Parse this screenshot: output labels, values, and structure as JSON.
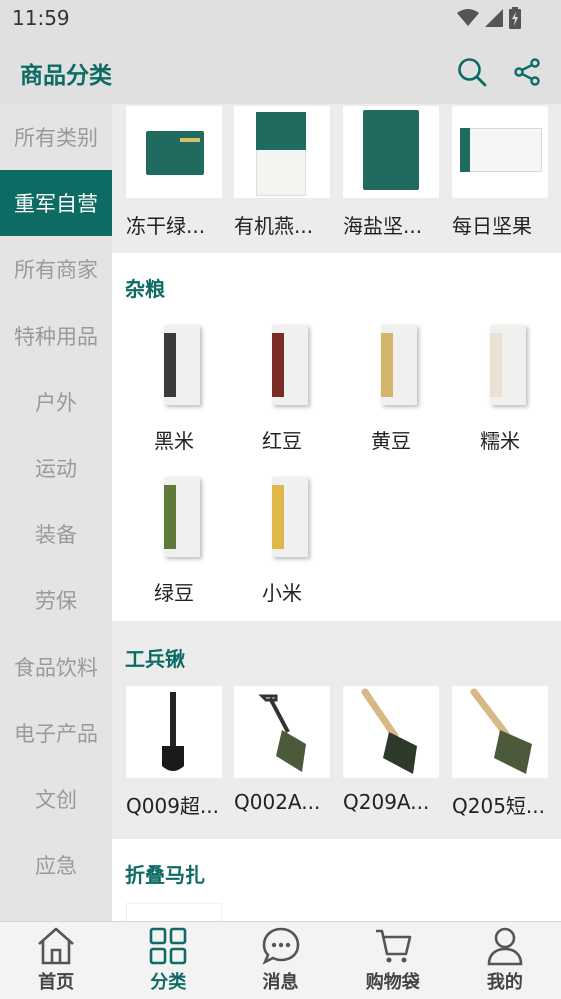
{
  "status_bar": {
    "time": "11:59"
  },
  "header": {
    "title": "商品分类"
  },
  "sidebar": {
    "items": [
      {
        "label": "所有类别"
      },
      {
        "label": "重军自营"
      },
      {
        "label": "所有商家"
      },
      {
        "label": "特种用品"
      },
      {
        "label": "户外"
      },
      {
        "label": "运动"
      },
      {
        "label": "装备"
      },
      {
        "label": "劳保"
      },
      {
        "label": "食品饮料"
      },
      {
        "label": "电子产品"
      },
      {
        "label": "文创"
      },
      {
        "label": "应急"
      }
    ],
    "active_index": 1
  },
  "sections": {
    "top_products": [
      {
        "label": "冻干绿..."
      },
      {
        "label": "有机燕..."
      },
      {
        "label": "海盐坚..."
      },
      {
        "label": "每日坚果"
      }
    ],
    "grains": {
      "title": "杂粮",
      "items": [
        {
          "label": "黑米",
          "color": "#3a3a3a"
        },
        {
          "label": "红豆",
          "color": "#7a2b22"
        },
        {
          "label": "黄豆",
          "color": "#d4b36a"
        },
        {
          "label": "糯米",
          "color": "#e8e2d2"
        },
        {
          "label": "绿豆",
          "color": "#5f7a3a"
        },
        {
          "label": "小米",
          "color": "#e0b84a"
        }
      ]
    },
    "shovels": {
      "title": "工兵锹",
      "items": [
        {
          "label": "Q009超..."
        },
        {
          "label": "Q002A..."
        },
        {
          "label": "Q209A..."
        },
        {
          "label": "Q205短..."
        }
      ]
    },
    "folding_stool": {
      "title": "折叠马扎"
    }
  },
  "bottom_nav": {
    "items": [
      {
        "label": "首页",
        "icon": "home-icon"
      },
      {
        "label": "分类",
        "icon": "grid-icon"
      },
      {
        "label": "消息",
        "icon": "chat-icon"
      },
      {
        "label": "购物袋",
        "icon": "cart-icon"
      },
      {
        "label": "我的",
        "icon": "user-icon"
      }
    ],
    "active_index": 1
  },
  "colors": {
    "accent": "#0d6b64",
    "sidebar_bg": "#e4e4e4",
    "header_bg": "#e0e0e0"
  }
}
